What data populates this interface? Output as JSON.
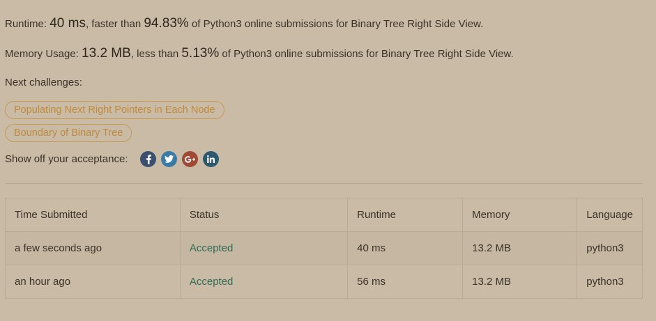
{
  "summary": {
    "runtime_label": "Runtime: ",
    "runtime_value": "40 ms",
    "runtime_mid": ", faster than ",
    "runtime_pct": "94.83%",
    "runtime_tail": " of Python3 online submissions for Binary Tree Right Side View.",
    "memory_label": "Memory Usage: ",
    "memory_value": "13.2 MB",
    "memory_mid": ", less than ",
    "memory_pct": "5.13%",
    "memory_tail": " of Python3 online submissions for Binary Tree Right Side View."
  },
  "next": {
    "label": "Next challenges:",
    "challenges": [
      "Populating Next Right Pointers in Each Node",
      "Boundary of Binary Tree"
    ]
  },
  "share": {
    "label": "Show off your acceptance:",
    "icons": [
      "facebook-icon",
      "twitter-icon",
      "google-plus-icon",
      "linkedin-icon"
    ],
    "colors": {
      "facebook": "#3b5070",
      "twitter": "#3a7aa6",
      "google_plus": "#a04a36",
      "linkedin": "#2d5970"
    }
  },
  "table": {
    "headers": [
      "Time Submitted",
      "Status",
      "Runtime",
      "Memory",
      "Language"
    ],
    "rows": [
      [
        "a few seconds ago",
        "Accepted",
        "40 ms",
        "13.2 MB",
        "python3"
      ],
      [
        "an hour ago",
        "Accepted",
        "56 ms",
        "13.2 MB",
        "python3"
      ]
    ]
  },
  "colors": {
    "background": "#c9bba5",
    "accent": "#c08a3a",
    "accepted": "#2f6b56"
  }
}
